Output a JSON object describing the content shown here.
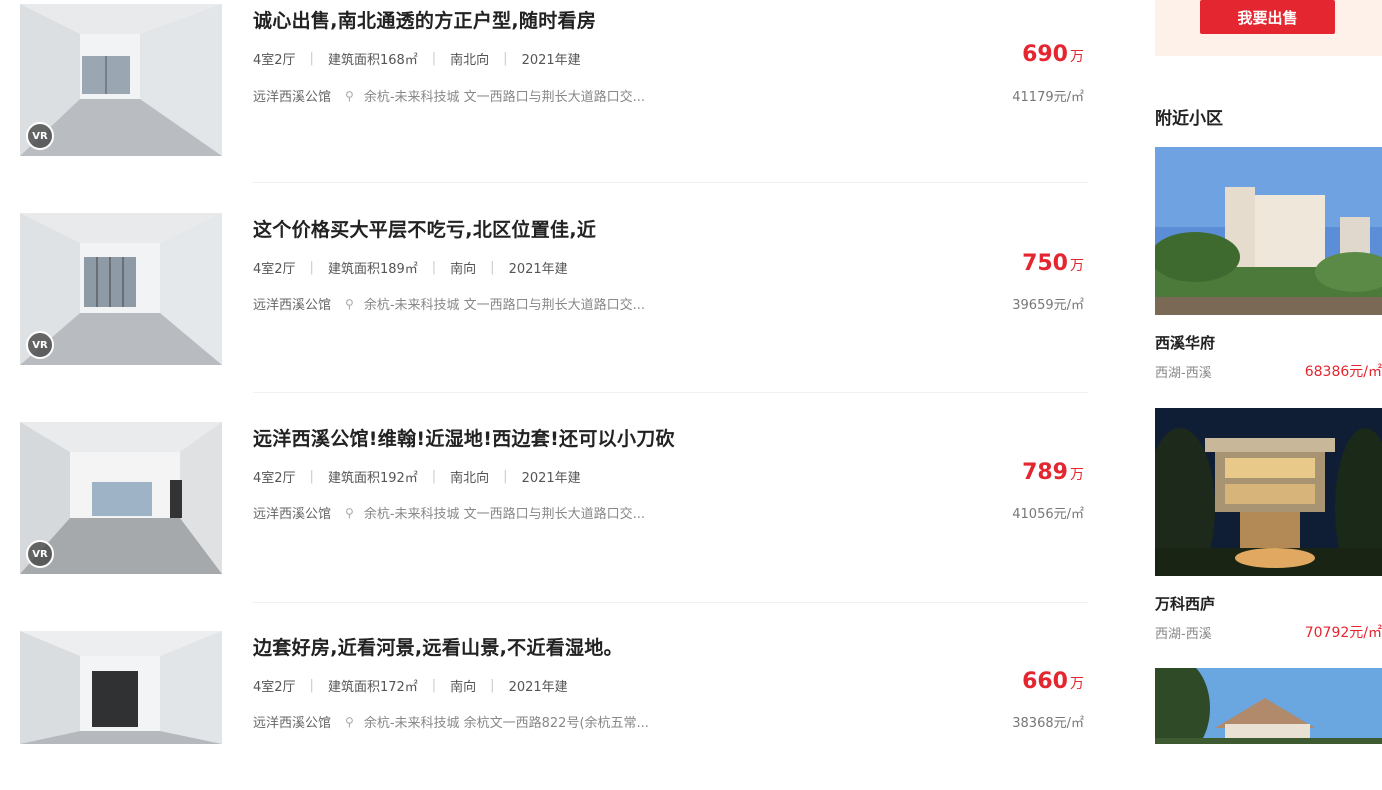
{
  "listings": [
    {
      "title": "诚心出售,南北通透的方正户型,随时看房",
      "rooms": "4室2厅",
      "area": "建筑面积168㎡",
      "orientation": "南北向",
      "year": "2021年建",
      "community": "远洋西溪公馆",
      "location": "余杭-未来科技城 文一西路口与荆长大道路口交...",
      "price": "690",
      "price_unit": "万",
      "unit_price": "41179元/㎡",
      "vr": "VR"
    },
    {
      "title": "这个价格买大平层不吃亏,北区位置佳,近",
      "rooms": "4室2厅",
      "area": "建筑面积189㎡",
      "orientation": "南向",
      "year": "2021年建",
      "community": "远洋西溪公馆",
      "location": "余杭-未来科技城 文一西路口与荆长大道路口交...",
      "price": "750",
      "price_unit": "万",
      "unit_price": "39659元/㎡",
      "vr": "VR"
    },
    {
      "title": "远洋西溪公馆!维翰!近湿地!西边套!还可以小刀砍",
      "rooms": "4室2厅",
      "area": "建筑面积192㎡",
      "orientation": "南北向",
      "year": "2021年建",
      "community": "远洋西溪公馆",
      "location": "余杭-未来科技城 文一西路口与荆长大道路口交...",
      "price": "789",
      "price_unit": "万",
      "unit_price": "41056元/㎡",
      "vr": "VR"
    },
    {
      "title": "边套好房,近看河景,远看山景,不近看湿地。",
      "rooms": "4室2厅",
      "area": "建筑面积172㎡",
      "orientation": "南向",
      "year": "2021年建",
      "community": "远洋西溪公馆",
      "location": "余杭-未来科技城 余杭文一西路822号(余杭五常...",
      "price": "660",
      "price_unit": "万",
      "unit_price": "38368元/㎡",
      "vr": ""
    }
  ],
  "sidebar": {
    "sell_button": "我要出售",
    "nearby_title": "附近小区",
    "communities": [
      {
        "name": "西溪华府",
        "area": "西湖-西溪",
        "price": "68386元/㎡"
      },
      {
        "name": "万科西庐",
        "area": "西湖-西溪",
        "price": "70792元/㎡"
      },
      {
        "name": "",
        "area": "",
        "price": ""
      }
    ]
  },
  "colors": {
    "accent": "#e3262f",
    "sell_box_bg": "#fdf1ea"
  },
  "icons": {
    "pin": "location-pin-icon",
    "vr": "vr-icon"
  }
}
